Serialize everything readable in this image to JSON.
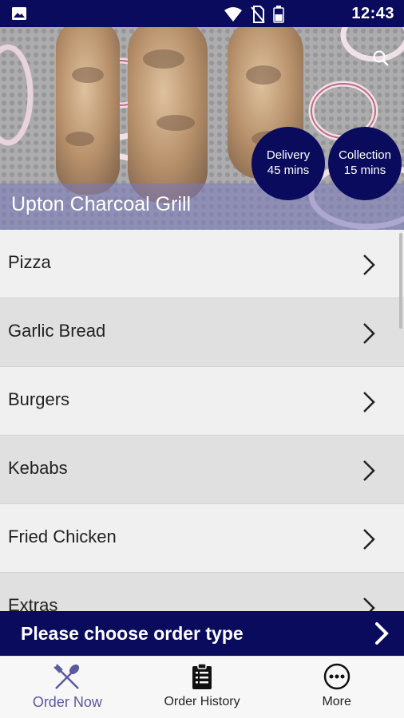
{
  "status_bar": {
    "time": "12:43",
    "icons": [
      "gallery-icon",
      "wifi-icon",
      "no-sim-icon",
      "battery-icon"
    ]
  },
  "restaurant": {
    "name": "Upton Charcoal Grill",
    "delivery": {
      "label": "Delivery",
      "time": "45 mins"
    },
    "collection": {
      "label": "Collection",
      "time": "15 mins"
    }
  },
  "menu": {
    "items": [
      {
        "label": "Pizza"
      },
      {
        "label": "Garlic Bread"
      },
      {
        "label": "Burgers"
      },
      {
        "label": "Kebabs"
      },
      {
        "label": "Fried Chicken"
      },
      {
        "label": "Extras"
      }
    ]
  },
  "order_bar": {
    "label": "Please choose order type"
  },
  "bottom_nav": {
    "order_now": "Order Now",
    "order_history": "Order History",
    "more": "More"
  },
  "colors": {
    "brand": "#0b0b5e",
    "active_tab": "#5a5aa0"
  }
}
